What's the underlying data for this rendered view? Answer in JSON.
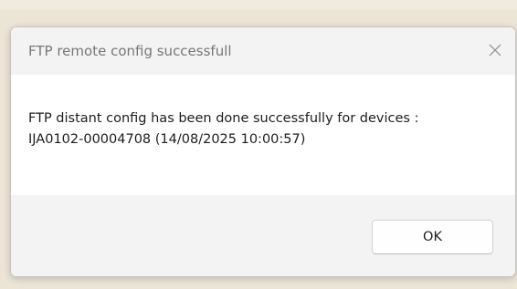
{
  "dialog": {
    "title": "FTP remote config successfull",
    "message_line1": "FTP distant config has been done successfully for devices :",
    "message_line2": "IJA0102-00004708 (14/08/2025 10:00:57)",
    "ok_label": "OK",
    "close_icon": "close-icon"
  },
  "colors": {
    "desktop_background": "#ece4d5",
    "titlebar_background": "#f3f3f3",
    "footer_background": "#f3f3f3",
    "content_background": "#ffffff",
    "title_text": "#777777",
    "body_text": "#1d1d1d"
  }
}
